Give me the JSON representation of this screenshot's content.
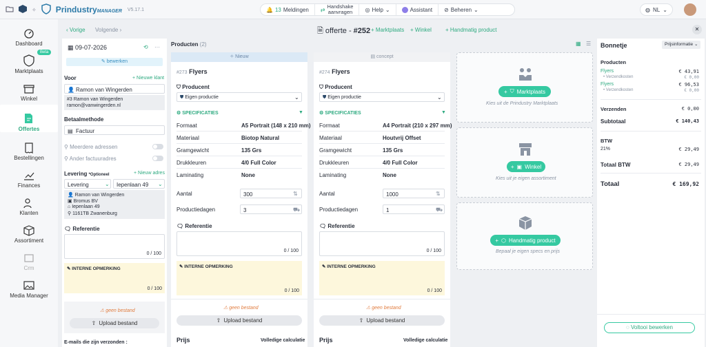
{
  "topbar": {
    "brand": "Prindustry",
    "brand_suffix": "MANAGER",
    "version": "V5.17.1",
    "notifications_count": "13",
    "notifications_label": "Meldingen",
    "handshake_line1": "Handshake",
    "handshake_line2": "aanvragen",
    "help": "Help",
    "assistant": "Assistant",
    "beheren": "Beheren",
    "lang": "NL"
  },
  "sidebar": {
    "items": [
      {
        "label": "Dashboard"
      },
      {
        "label": "Marktplaats",
        "badge": "Beta"
      },
      {
        "label": "Winkel"
      },
      {
        "label": "Offertes"
      },
      {
        "label": "Bestellingen"
      },
      {
        "label": "Finances"
      },
      {
        "label": "Klanten"
      },
      {
        "label": "Assortiment"
      },
      {
        "label": "Crm"
      },
      {
        "label": "Media Manager"
      }
    ]
  },
  "header": {
    "prev": "Vorige",
    "next": "Volgende",
    "title_prefix": "offerte - ",
    "number": "#252",
    "add_marktplaats": "Marktplaats",
    "add_winkel": "Winkel",
    "add_handmatig": "Handmatig product"
  },
  "left": {
    "date": "09-07-2026",
    "edit": "bewerken",
    "voor_label": "Voor",
    "new_client": "Nieuwe klant",
    "client": "Ramon van Wingerden",
    "contact_line1": "#3 Ramon van Wingerden",
    "contact_line2": "ramon@vanwingerden.nl",
    "betaal_label": "Betaalmethode",
    "betaal_value": "Factuur",
    "meerdere": "Meerdere adressen",
    "ander": "Ander factuuradres",
    "levering_label": "Levering",
    "levering_opt": "*Optioneel",
    "new_address": "Nieuw adres",
    "levering_type": "Levering",
    "levering_addr": "Iepenlaan 49",
    "addr_name": "Ramon van Wingerden",
    "addr_company": "Bromus BV",
    "addr_street": "Iepenlaan 49",
    "addr_city": "1161TB Zwanenburg",
    "referentie": "Referentie",
    "ref_count": "0 / 100",
    "interne": "INTERNE OPMERKING",
    "interne_count": "0 / 100",
    "geen_bestand": "geen bestand",
    "upload": "Upload bestand",
    "emails": "E-mails die zijn verzonden :"
  },
  "products_header": {
    "label": "Producten",
    "count": "(2)"
  },
  "products": [
    {
      "tab": "Nieuw",
      "number": "#273",
      "name": "Flyers",
      "producent": "Producent",
      "producent_value": "Eigen productie",
      "specs": "SPECIFICATIES",
      "rows": [
        {
          "k": "Formaat",
          "v": "A5 Portrait (148 x 210 mm)"
        },
        {
          "k": "Materiaal",
          "v": "Biotop Natural"
        },
        {
          "k": "Gramgewicht",
          "v": "135 Grs"
        },
        {
          "k": "Drukkleuren",
          "v": "4/0 Full Color"
        },
        {
          "k": "Laminating",
          "v": "None"
        }
      ],
      "aantal_label": "Aantal",
      "aantal": "300",
      "dagen_label": "Productiedagen",
      "dagen": "3",
      "referentie": "Referentie",
      "ref_count": "0 / 100",
      "interne": "INTERNE OPMERKING",
      "interne_count": "0 / 100",
      "geen_bestand": "geen bestand",
      "upload": "Upload bestand",
      "prijs": "Prijs",
      "calc": "Volledige calculatie"
    },
    {
      "tab": "concept",
      "number": "#274",
      "name": "Flyers",
      "producent": "Producent",
      "producent_value": "Eigen productie",
      "specs": "SPECIFICATIES",
      "rows": [
        {
          "k": "Formaat",
          "v": "A4 Portrait (210 x 297 mm)"
        },
        {
          "k": "Materiaal",
          "v": "Houtvrij Offset"
        },
        {
          "k": "Gramgewicht",
          "v": "135 Grs"
        },
        {
          "k": "Drukkleuren",
          "v": "4/0 Full Color"
        },
        {
          "k": "Laminating",
          "v": "None"
        }
      ],
      "aantal_label": "Aantal",
      "aantal": "1000",
      "dagen_label": "Productiedagen",
      "dagen": "1",
      "referentie": "Referentie",
      "ref_count": "0 / 100",
      "interne": "INTERNE OPMERKING",
      "interne_count": "0 / 100",
      "geen_bestand": "geen bestand",
      "upload": "Upload bestand",
      "prijs": "Prijs",
      "calc": "Volledige calculatie"
    }
  ],
  "add_cards": [
    {
      "button": "Marktplaats",
      "caption": "Kies uit de Prindustry Marktplaats"
    },
    {
      "button": "Winkel",
      "caption": "Kies uit je eigen assortiment"
    },
    {
      "button": "Handmatig product",
      "caption": "Bepaal je eigen specs en prijs"
    }
  ],
  "bonnetje": {
    "title": "Bonnetje",
    "info": "Prijsinformatie",
    "producten": "Producten",
    "lines": [
      {
        "name": "Flyers",
        "price": "€ 43,91",
        "sub": "Verzendkosten",
        "sub_price": "€ 0,00"
      },
      {
        "name": "Flyers",
        "price": "€ 96,53",
        "sub": "Verzendkosten",
        "sub_price": "€ 0,00"
      }
    ],
    "verzenden": "Verzenden",
    "verzenden_val": "€ 0,00",
    "subtotaal": "Subtotaal",
    "subtotaal_val": "€ 140,43",
    "btw": "BTW",
    "btw_rate": "21%",
    "btw_val": "€ 29,49",
    "totaal_btw": "Totaal BTW",
    "totaal_btw_val": "€ 29,49",
    "totaal": "Totaal",
    "totaal_val": "€ 169,92",
    "voltooi": "Voltooi bewerken"
  },
  "colors": {
    "accent": "#35c9a1",
    "brand": "#2c7aa8",
    "note": "#fdf7dc"
  }
}
